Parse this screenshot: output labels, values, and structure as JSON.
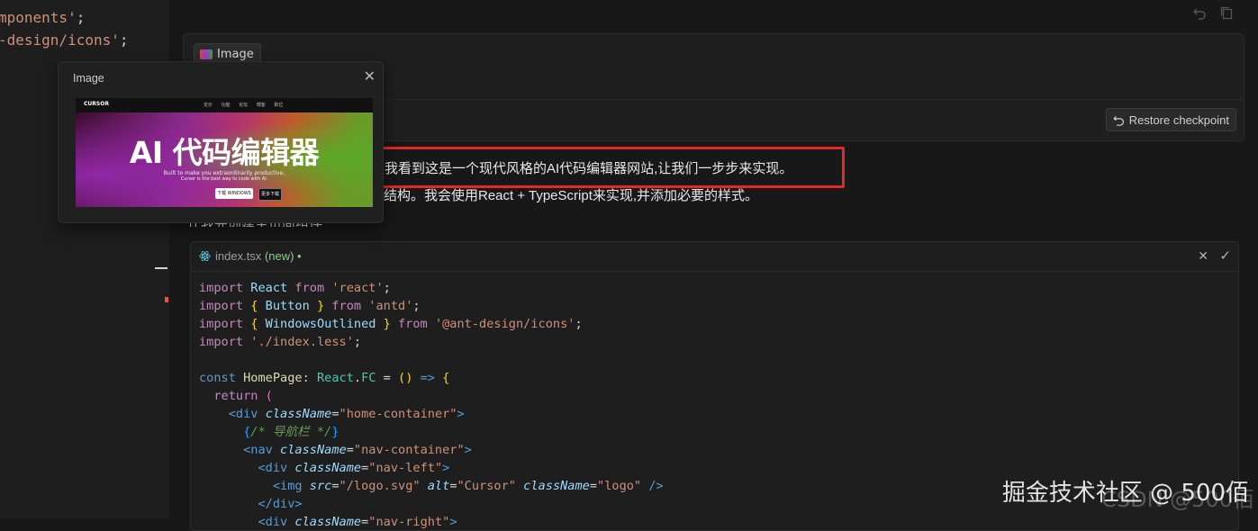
{
  "left_editor": {
    "lines": [
      "mponents'",
      "-design/icons'"
    ]
  },
  "chat": {
    "user_message": {
      "image_chip_label": "Image",
      "restore_button_label": "Restore checkpoint"
    },
    "response": {
      "line1": "我看到这是一个现代风格的AI代码编辑器网站,让我们一步步来实现。",
      "line2": "结构。我会使用React + TypeScript来实现,并添加必要的样式。",
      "line3": "让我先创建主页面组件:"
    },
    "code_block": {
      "file_name": "index.tsx",
      "file_status": "(new) •"
    }
  },
  "image_popover": {
    "title": "Image",
    "preview": {
      "logo": "CURSOR",
      "nav_links": "定价 功能 论坛 博客 职位",
      "headline": "AI 代码编辑器",
      "sub1": "Built to make you extraordinarily productive,",
      "sub2": "Cursor is the best way to code with AI.",
      "button_primary": "下载 WINDOWS",
      "button_secondary": "更多下载"
    }
  },
  "watermark": {
    "text": "掘金技术社区 @ 500佰",
    "sub": "CSDN @500佰"
  },
  "colors": {
    "highlight": "#e5282a",
    "background": "#181818"
  }
}
